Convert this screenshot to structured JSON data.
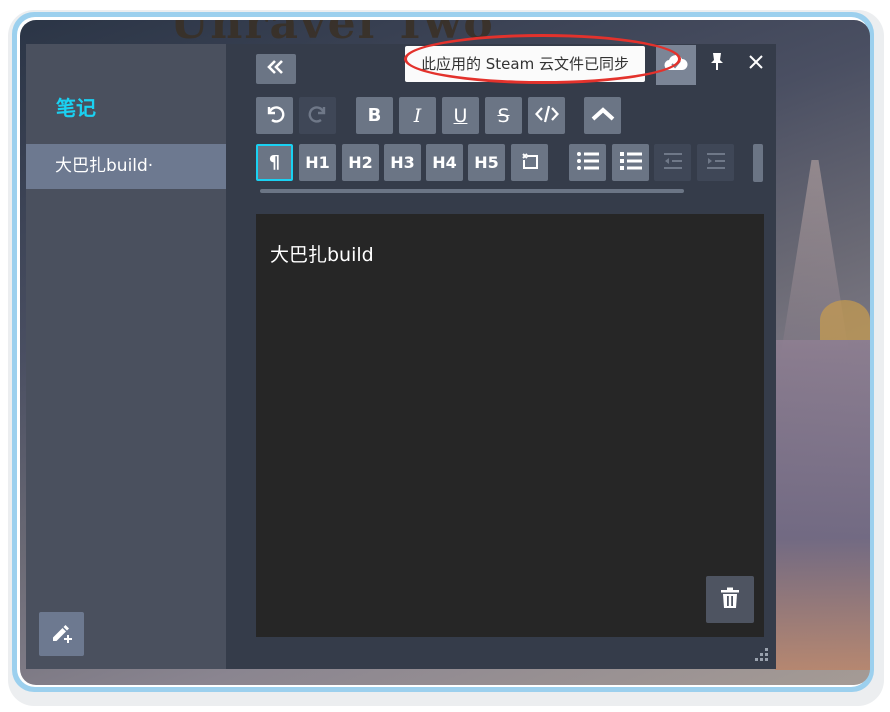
{
  "background": {
    "game_title": "Unravel Two"
  },
  "sidebar": {
    "title": "笔记",
    "notes": [
      "大巴扎build·"
    ],
    "new_note_icon": "pencil-plus-icon"
  },
  "toolbar": {
    "collapse_icon": "double-chevron-left-icon",
    "undo_icon": "undo-icon",
    "redo_icon": "redo-icon",
    "bold": "B",
    "italic": "I",
    "underline": "U",
    "strike": "S",
    "code_icon": "code-icon",
    "collapse_toolbar_icon": "chevron-up-icon",
    "paragraph": "¶",
    "h1": "H1",
    "h2": "H2",
    "h3": "H3",
    "h4": "H4",
    "h5": "H5",
    "quote_icon": "quote-icon",
    "bullet_icon": "bulleted-list-icon",
    "numbered_icon": "numbered-list-icon",
    "outdent_icon": "outdent-icon",
    "indent_icon": "indent-icon"
  },
  "editor": {
    "content": "大巴扎build"
  },
  "window": {
    "sync_tooltip": "此应用的 Steam 云文件已同步",
    "cloud_icon": "cloud-check-icon",
    "pin_icon": "pin-icon",
    "close_icon": "close-icon",
    "delete_icon": "trash-icon"
  },
  "colors": {
    "accent": "#1ad1f2",
    "annotation": "#e3322c"
  }
}
